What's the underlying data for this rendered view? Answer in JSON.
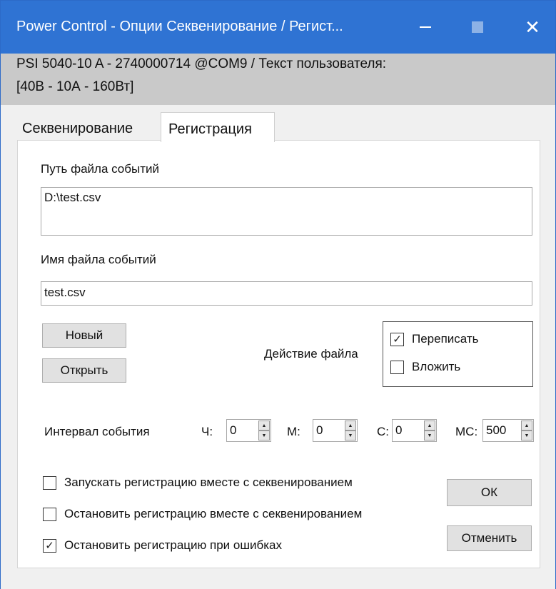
{
  "window": {
    "title": "Power Control - Опции Секвенирование / Регист...",
    "min_glyph": "–",
    "close_glyph": "✕"
  },
  "device": {
    "line1": "PSI 5040-10 A - 2740000714 @COM9 / Текст пользователя:",
    "line2": "[40В - 10А - 160Вт]"
  },
  "tabs": [
    {
      "label": "Секвенирование",
      "active": false
    },
    {
      "label": "Регистрация",
      "active": true
    }
  ],
  "logging": {
    "path_label": "Путь файла событий",
    "path_value": "D:\\test.csv",
    "name_label": "Имя файла событий",
    "name_value": "test.csv",
    "new_button": "Новый",
    "open_button": "Открыть",
    "file_action_label": "Действие файла",
    "overwrite_label": "Переписать",
    "overwrite_checked": true,
    "append_label": "Вложить",
    "append_checked": false,
    "interval_label": "Интервал события",
    "hours_label": "Ч:",
    "hours_value": "0",
    "minutes_label": "М:",
    "minutes_value": "0",
    "seconds_label": "С:",
    "seconds_value": "0",
    "ms_label": "МС:",
    "ms_value": "500",
    "start_with_seq_label": "Запускать регистрацию вместе с секвенированием",
    "start_with_seq_checked": false,
    "stop_with_seq_label": "Остановить регистрацию вместе с секвенированием",
    "stop_with_seq_checked": false,
    "stop_on_error_label": "Остановить регистрацию при ошибках",
    "stop_on_error_checked": true,
    "ok_button": "ОК",
    "cancel_button": "Отменить",
    "check_glyph": "✓"
  },
  "colors": {
    "titlebar": "#2f73d3",
    "header_band": "#c9c9c9",
    "button_face": "#e1e1e1"
  }
}
